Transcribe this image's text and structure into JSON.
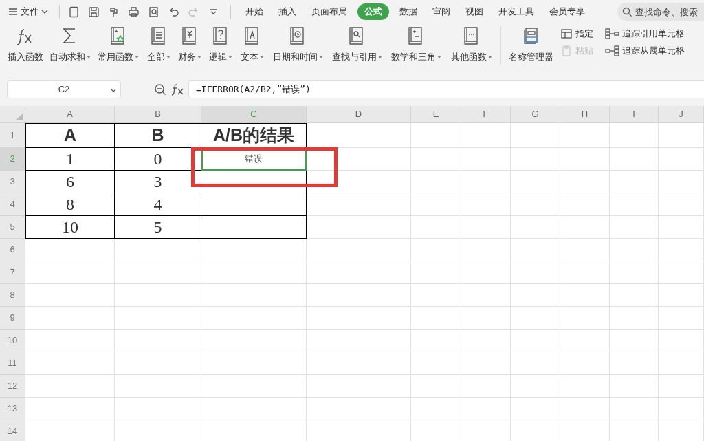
{
  "menu": {
    "label": "文件"
  },
  "tabs": [
    {
      "label": "开始",
      "selected": false
    },
    {
      "label": "插入",
      "selected": false
    },
    {
      "label": "页面布局",
      "selected": false
    },
    {
      "label": "公式",
      "selected": true
    },
    {
      "label": "数据",
      "selected": false
    },
    {
      "label": "审阅",
      "selected": false
    },
    {
      "label": "视图",
      "selected": false
    },
    {
      "label": "开发工具",
      "selected": false
    },
    {
      "label": "会员专享",
      "selected": false
    }
  ],
  "search": {
    "placeholder": "查找命令、搜索"
  },
  "ribbon": {
    "large_buttons": [
      {
        "label": "插入函数",
        "dropdown": false
      },
      {
        "label": "自动求和",
        "dropdown": true
      },
      {
        "label": "常用函数",
        "dropdown": true
      },
      {
        "label": "全部",
        "dropdown": true
      },
      {
        "label": "财务",
        "dropdown": true
      },
      {
        "label": "逻辑",
        "dropdown": true
      },
      {
        "label": "文本",
        "dropdown": true
      },
      {
        "label": "日期和时间",
        "dropdown": true
      },
      {
        "label": "查找与引用",
        "dropdown": true
      },
      {
        "label": "数学和三角",
        "dropdown": true
      },
      {
        "label": "其他函数",
        "dropdown": true
      },
      {
        "label": "名称管理器",
        "dropdown": false
      }
    ],
    "small_buttons": [
      {
        "label": "指定",
        "disabled": false
      },
      {
        "label": "粘贴",
        "disabled": true
      }
    ],
    "trace_buttons": [
      {
        "label": "追踪引用单元格"
      },
      {
        "label": "追踪从属单元格"
      }
    ]
  },
  "name_box": {
    "value": "C2"
  },
  "formula": {
    "value": "=IFERROR(A2/B2,”错误”)"
  },
  "columns": [
    {
      "label": "A",
      "selected": false
    },
    {
      "label": "B",
      "selected": false
    },
    {
      "label": "C",
      "selected": true
    },
    {
      "label": "D",
      "selected": false
    },
    {
      "label": "E",
      "selected": false
    },
    {
      "label": "F",
      "selected": false
    },
    {
      "label": "G",
      "selected": false
    },
    {
      "label": "H",
      "selected": false
    },
    {
      "label": "I",
      "selected": false
    },
    {
      "label": "J",
      "selected": false
    }
  ],
  "rows": [
    {
      "label": "1",
      "selected": false,
      "kind": "header",
      "cells": [
        "A",
        "B",
        "A/B的结果"
      ]
    },
    {
      "label": "2",
      "selected": true,
      "kind": "data",
      "cells": [
        "1",
        "0",
        "错误"
      ]
    },
    {
      "label": "3",
      "selected": false,
      "kind": "data",
      "cells": [
        "6",
        "3",
        ""
      ]
    },
    {
      "label": "4",
      "selected": false,
      "kind": "data",
      "cells": [
        "8",
        "4",
        ""
      ]
    },
    {
      "label": "5",
      "selected": false,
      "kind": "data",
      "cells": [
        "10",
        "5",
        ""
      ]
    },
    {
      "label": "6",
      "selected": false
    },
    {
      "label": "7",
      "selected": false
    },
    {
      "label": "8",
      "selected": false
    },
    {
      "label": "9",
      "selected": false
    },
    {
      "label": "10",
      "selected": false
    },
    {
      "label": "11",
      "selected": false
    },
    {
      "label": "12",
      "selected": false
    },
    {
      "label": "13",
      "selected": false
    },
    {
      "label": "14",
      "selected": false
    }
  ]
}
